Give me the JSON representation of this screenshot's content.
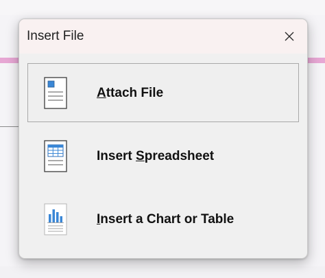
{
  "dialog": {
    "title": "Insert File",
    "close_icon": "close-icon"
  },
  "options": [
    {
      "pre": "",
      "key": "A",
      "post": "ttach File",
      "icon": "document-icon",
      "selected": true
    },
    {
      "pre": "Insert ",
      "key": "S",
      "post": "preadsheet",
      "icon": "spreadsheet-icon",
      "selected": false
    },
    {
      "pre": "",
      "key": "I",
      "post": "nsert a Chart or Table",
      "icon": "chart-document-icon",
      "selected": false
    }
  ],
  "colors": {
    "accent_blue": "#3a87d6",
    "titlebar": "#f9f1f1",
    "dialog_bg": "#f0f0f0",
    "background_stripe": "#e7a7d4"
  }
}
